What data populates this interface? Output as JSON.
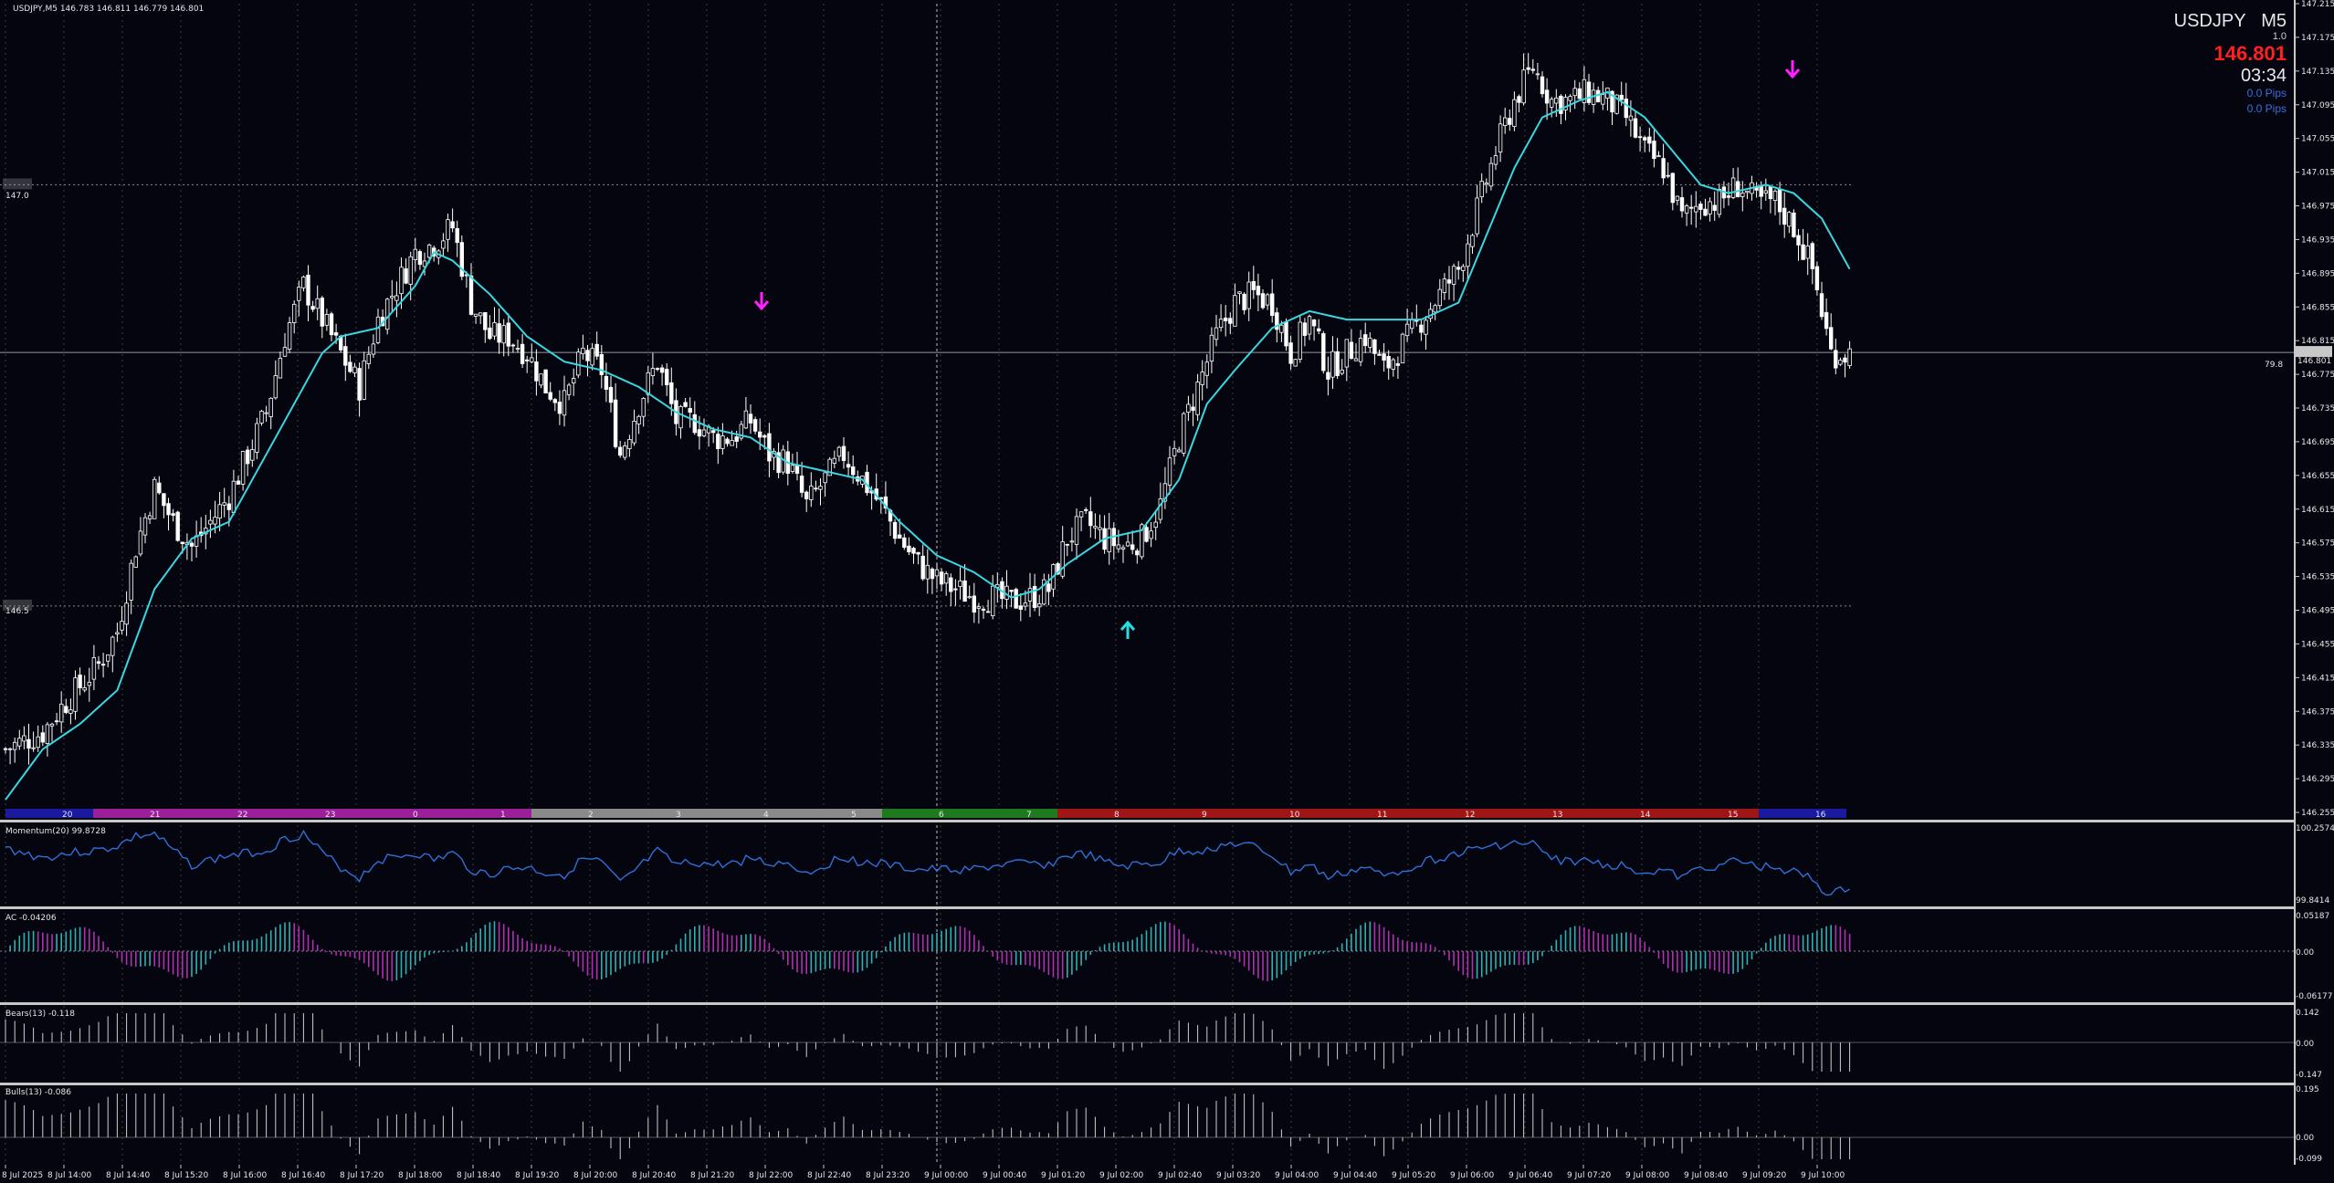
{
  "header": {
    "title": "USDJPY,M5  146.783 146.811 146.779 146.801"
  },
  "info_panel": {
    "symbol": "USDJPY",
    "timeframe": "M5",
    "multiplier": "1.0",
    "bid": "146.801",
    "countdown": "03:34",
    "pips_1": "0.0 Pips",
    "pips_2": "0.0 Pips"
  },
  "price_axis": {
    "ticks": [
      "147.215",
      "147.175",
      "147.135",
      "147.095",
      "147.055",
      "147.015",
      "146.975",
      "146.935",
      "146.895",
      "146.855",
      "146.815",
      "146.775",
      "146.735",
      "146.695",
      "146.655",
      "146.615",
      "146.575",
      "146.535",
      "146.495",
      "146.455",
      "146.415",
      "146.375",
      "146.335",
      "146.295",
      "146.255"
    ],
    "current_price_tag": "146.801",
    "spread_tag": "79.8",
    "level_147_label": "147.0",
    "level_1465_label": "146.5"
  },
  "hour_bar": {
    "labels": [
      "20",
      "21",
      "22",
      "23",
      "0",
      "1",
      "2",
      "3",
      "4",
      "5",
      "6",
      "7",
      "8",
      "9",
      "10",
      "11",
      "12",
      "13",
      "14",
      "15",
      "16"
    ],
    "colors": [
      "#1a1aa0",
      "#9b1f9b",
      "#9b1f9b",
      "#9b1f9b",
      "#9b1f9b",
      "#9b1f9b",
      "#8a8a8a",
      "#8a8a8a",
      "#8a8a8a",
      "#8a8a8a",
      "#1e7a1e",
      "#1e7a1e",
      "#a01515",
      "#a01515",
      "#a01515",
      "#a01515",
      "#a01515",
      "#a01515",
      "#a01515",
      "#a01515",
      "#1a1aa0"
    ]
  },
  "time_axis": {
    "labels": [
      "8 Jul 2025",
      "8 Jul 14:00",
      "8 Jul 14:40",
      "8 Jul 15:20",
      "8 Jul 16:00",
      "8 Jul 16:40",
      "8 Jul 17:20",
      "8 Jul 18:00",
      "8 Jul 18:40",
      "8 Jul 19:20",
      "8 Jul 20:00",
      "8 Jul 20:40",
      "8 Jul 21:20",
      "8 Jul 22:00",
      "8 Jul 22:40",
      "8 Jul 23:20",
      "9 Jul 00:00",
      "9 Jul 00:40",
      "9 Jul 01:20",
      "9 Jul 02:00",
      "9 Jul 02:40",
      "9 Jul 03:20",
      "9 Jul 04:00",
      "9 Jul 04:40",
      "9 Jul 05:20",
      "9 Jul 06:00",
      "9 Jul 06:40",
      "9 Jul 07:20",
      "9 Jul 08:00",
      "9 Jul 08:40",
      "9 Jul 09:20",
      "9 Jul 10:00"
    ]
  },
  "indicators": {
    "momentum": {
      "label": "Momentum(20) 99.8728",
      "ticks": [
        "100.2574",
        "99.8414"
      ]
    },
    "ac": {
      "label": "AC -0.04206",
      "ticks": [
        "0.05187",
        "0.00",
        "-0.06177"
      ]
    },
    "bears": {
      "label": "Bears(13) -0.118",
      "ticks": [
        "0.142",
        "0.00",
        "-0.147"
      ]
    },
    "bulls": {
      "label": "Bulls(13) -0.086",
      "ticks": [
        "0.195",
        "0.00",
        "-0.099"
      ]
    }
  },
  "colors": {
    "background": "#050510",
    "grid": "#3a3a3a",
    "candle_up": "#ffffff",
    "candle_down": "#ffffff",
    "ma_line": "#39d7e0",
    "momentum_line": "#2f6fd6",
    "ac_up": "#2bb3b3",
    "ac_down": "#b030b0",
    "bid_red": "#ff2020",
    "pips_blue": "#3a6fd8",
    "arrow_down": "#ff22ff",
    "arrow_up": "#22e0e0"
  },
  "chart_data": {
    "type": "candlestick",
    "symbol": "USDJPY",
    "timeframe": "M5",
    "ylim": [
      146.255,
      147.215
    ],
    "close_anchors": [
      [
        0,
        146.33
      ],
      [
        8,
        146.35
      ],
      [
        12,
        146.38
      ],
      [
        20,
        146.43
      ],
      [
        24,
        146.47
      ],
      [
        28,
        146.57
      ],
      [
        32,
        146.64
      ],
      [
        36,
        146.6
      ],
      [
        40,
        146.57
      ],
      [
        44,
        146.6
      ],
      [
        48,
        146.63
      ],
      [
        52,
        146.68
      ],
      [
        56,
        146.73
      ],
      [
        60,
        146.82
      ],
      [
        64,
        146.88
      ],
      [
        68,
        146.84
      ],
      [
        72,
        146.8
      ],
      [
        76,
        146.76
      ],
      [
        80,
        146.84
      ],
      [
        84,
        146.88
      ],
      [
        88,
        146.92
      ],
      [
        92,
        146.93
      ],
      [
        96,
        146.95
      ],
      [
        100,
        146.86
      ],
      [
        104,
        146.82
      ],
      [
        108,
        146.82
      ],
      [
        112,
        146.8
      ],
      [
        116,
        146.76
      ],
      [
        120,
        146.74
      ],
      [
        124,
        146.8
      ],
      [
        128,
        146.78
      ],
      [
        132,
        146.68
      ],
      [
        136,
        146.74
      ],
      [
        140,
        146.79
      ],
      [
        144,
        146.72
      ],
      [
        148,
        146.72
      ],
      [
        152,
        146.7
      ],
      [
        156,
        146.7
      ],
      [
        160,
        146.72
      ],
      [
        164,
        146.68
      ],
      [
        168,
        146.67
      ],
      [
        172,
        146.62
      ],
      [
        176,
        146.65
      ],
      [
        180,
        146.68
      ],
      [
        184,
        146.65
      ],
      [
        188,
        146.62
      ],
      [
        192,
        146.58
      ],
      [
        196,
        146.55
      ],
      [
        200,
        146.53
      ],
      [
        204,
        146.52
      ],
      [
        208,
        146.51
      ],
      [
        212,
        146.51
      ],
      [
        216,
        146.505
      ],
      [
        220,
        146.51
      ],
      [
        224,
        146.52
      ],
      [
        228,
        146.58
      ],
      [
        232,
        146.6
      ],
      [
        236,
        146.58
      ],
      [
        240,
        146.57
      ],
      [
        244,
        146.58
      ],
      [
        248,
        146.62
      ],
      [
        252,
        146.7
      ],
      [
        256,
        146.76
      ],
      [
        260,
        146.82
      ],
      [
        264,
        146.86
      ],
      [
        268,
        146.87
      ],
      [
        272,
        146.86
      ],
      [
        276,
        146.8
      ],
      [
        280,
        146.84
      ],
      [
        284,
        146.78
      ],
      [
        288,
        146.8
      ],
      [
        292,
        146.82
      ],
      [
        296,
        146.78
      ],
      [
        300,
        146.81
      ],
      [
        304,
        146.84
      ],
      [
        308,
        146.87
      ],
      [
        312,
        146.9
      ],
      [
        316,
        146.97
      ],
      [
        320,
        147.04
      ],
      [
        324,
        147.1
      ],
      [
        328,
        147.14
      ],
      [
        332,
        147.1
      ],
      [
        336,
        147.1
      ],
      [
        340,
        147.11
      ],
      [
        344,
        147.1
      ],
      [
        348,
        147.08
      ],
      [
        352,
        147.04
      ],
      [
        356,
        147.02
      ],
      [
        360,
        146.96
      ],
      [
        364,
        146.98
      ],
      [
        368,
        146.98
      ],
      [
        372,
        147.0
      ],
      [
        376,
        146.98
      ],
      [
        380,
        146.98
      ],
      [
        384,
        146.95
      ],
      [
        388,
        146.9
      ],
      [
        392,
        146.8
      ],
      [
        396,
        146.8
      ]
    ],
    "ma_anchors": [
      [
        0,
        146.27
      ],
      [
        8,
        146.33
      ],
      [
        16,
        146.36
      ],
      [
        24,
        146.4
      ],
      [
        32,
        146.52
      ],
      [
        40,
        146.58
      ],
      [
        48,
        146.6
      ],
      [
        56,
        146.68
      ],
      [
        64,
        146.76
      ],
      [
        68,
        146.8
      ],
      [
        72,
        146.82
      ],
      [
        80,
        146.83
      ],
      [
        88,
        146.88
      ],
      [
        92,
        146.92
      ],
      [
        96,
        146.91
      ],
      [
        104,
        146.87
      ],
      [
        112,
        146.82
      ],
      [
        120,
        146.79
      ],
      [
        128,
        146.78
      ],
      [
        136,
        146.76
      ],
      [
        144,
        146.73
      ],
      [
        152,
        146.71
      ],
      [
        160,
        146.7
      ],
      [
        168,
        146.67
      ],
      [
        176,
        146.66
      ],
      [
        184,
        146.65
      ],
      [
        192,
        146.6
      ],
      [
        200,
        146.56
      ],
      [
        208,
        146.54
      ],
      [
        216,
        146.51
      ],
      [
        222,
        146.52
      ],
      [
        228,
        146.55
      ],
      [
        236,
        146.58
      ],
      [
        244,
        146.59
      ],
      [
        252,
        146.65
      ],
      [
        258,
        146.74
      ],
      [
        264,
        146.78
      ],
      [
        272,
        146.83
      ],
      [
        280,
        146.85
      ],
      [
        288,
        146.84
      ],
      [
        296,
        146.84
      ],
      [
        304,
        146.84
      ],
      [
        312,
        146.86
      ],
      [
        318,
        146.94
      ],
      [
        324,
        147.02
      ],
      [
        330,
        147.08
      ],
      [
        338,
        147.1
      ],
      [
        344,
        147.11
      ],
      [
        352,
        147.08
      ],
      [
        358,
        147.04
      ],
      [
        364,
        147.0
      ],
      [
        370,
        146.99
      ],
      [
        378,
        147.0
      ],
      [
        384,
        146.99
      ],
      [
        390,
        146.96
      ],
      [
        396,
        146.9
      ]
    ]
  }
}
